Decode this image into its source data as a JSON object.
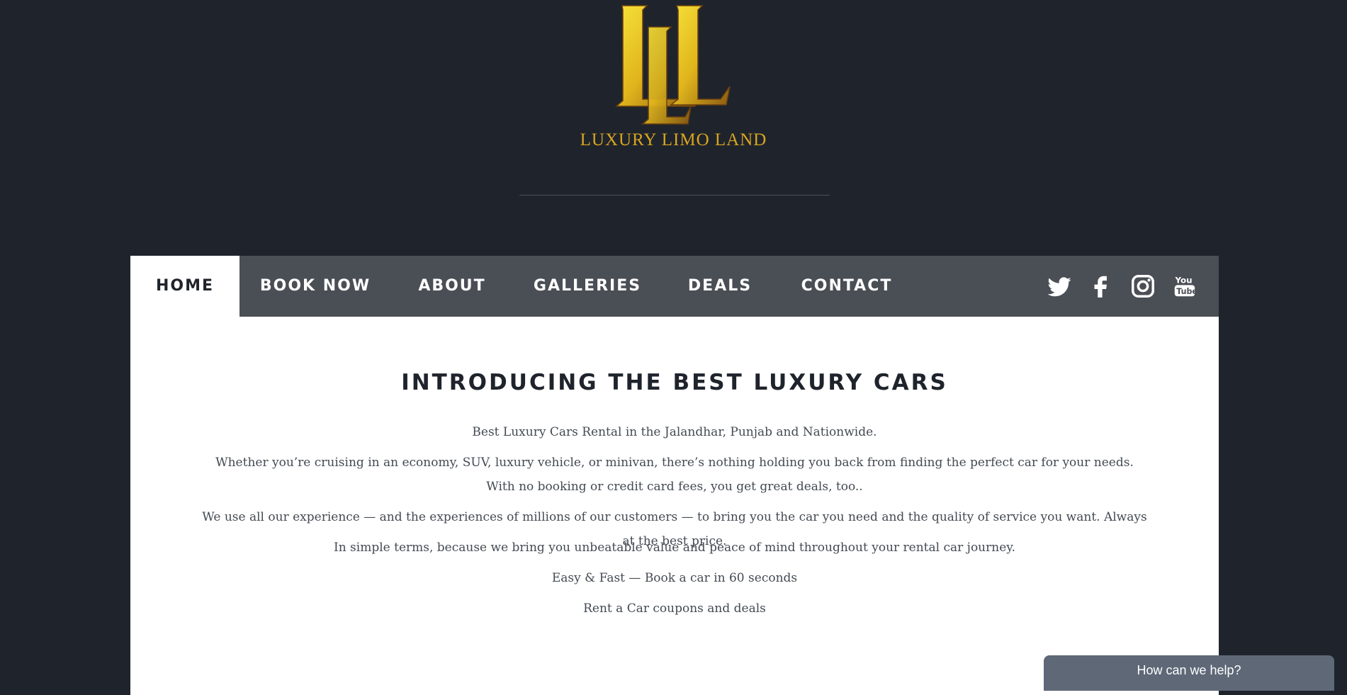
{
  "brand": {
    "logo_monogram": "LLL",
    "name": "LUXURY LIMO LAND"
  },
  "nav": {
    "items": [
      {
        "label": "HOME",
        "active": true
      },
      {
        "label": "BOOK NOW",
        "active": false
      },
      {
        "label": "ABOUT",
        "active": false
      },
      {
        "label": "GALLERIES",
        "active": false
      },
      {
        "label": "DEALS",
        "active": false
      },
      {
        "label": "CONTACT",
        "active": false
      }
    ],
    "social": [
      "twitter-icon",
      "facebook-icon",
      "instagram-icon",
      "youtube-icon"
    ]
  },
  "main": {
    "headline": "INTRODUCING THE BEST LUXURY CARS",
    "paragraphs": [
      "Best Luxury Cars Rental in the Jalandhar, Punjab and Nationwide.",
      "Whether you’re cruising in an economy, SUV, luxury vehicle, or minivan, there’s nothing holding you back from finding the perfect car for your needs. With no booking or credit card fees, you get great deals, too..",
      "We use all our experience — and the experiences of millions of our customers — to bring you the car you need and the quality of service you want. Always at the best price.",
      "In simple terms, because we bring you unbeatable value and peace of mind throughout your rental car journey.",
      "Easy & Fast — Book a car in 60 seconds",
      "Rent a Car coupons and deals"
    ]
  },
  "chat": {
    "label": "How can we help?"
  },
  "colors": {
    "background": "#1f242c",
    "nav_bar": "#4a4e55",
    "gold": "#d9a520",
    "chat": "#5e6877"
  }
}
